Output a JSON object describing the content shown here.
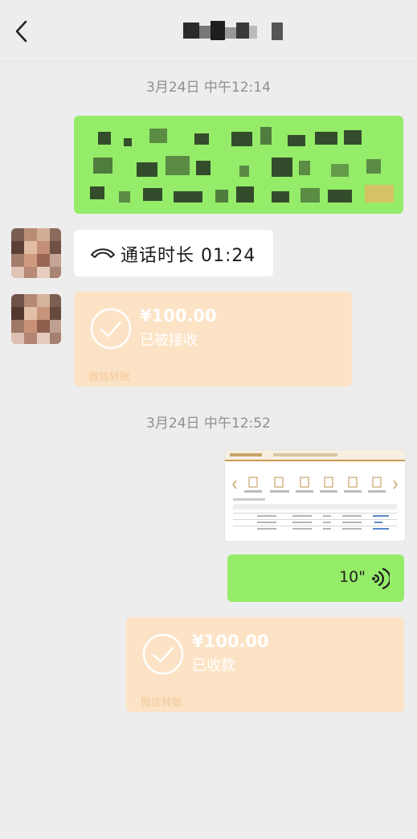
{
  "header": {
    "back_icon": "chevron-left-icon"
  },
  "messages": {
    "ts1": "3月24日 中午12:14",
    "call": {
      "icon": "phone-hangup-icon",
      "text": "通话时长 01:24"
    },
    "transfer1": {
      "icon": "check-circle-icon",
      "amount": "¥100.00",
      "status": "已被接收",
      "brand": "微信转账"
    },
    "ts2": "3月24日 中午12:52",
    "voice": {
      "duration": "10\"",
      "icon": "voice-wave-icon"
    },
    "transfer2": {
      "icon": "check-circle-icon",
      "amount": "¥100.00",
      "status": "已收款",
      "brand": "微信转账"
    }
  },
  "colors": {
    "sent_bubble": "#95ec69",
    "transfer_bubble": "#fce3c5",
    "background": "#ededed"
  }
}
